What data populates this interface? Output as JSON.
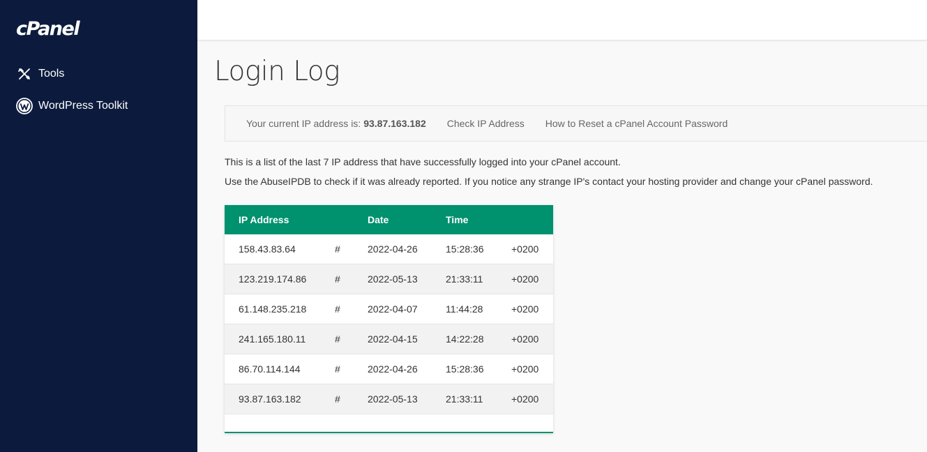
{
  "app": {
    "logo": "cPanel"
  },
  "sidebar": {
    "items": [
      {
        "label": "Tools",
        "icon": "tools-icon"
      },
      {
        "label": "WordPress Toolkit",
        "icon": "wordpress-icon"
      }
    ]
  },
  "page": {
    "title": "Login Log"
  },
  "info": {
    "ip_label": "Your current IP address is:",
    "ip_value": "93.87.163.182",
    "link_check": "Check IP Address",
    "link_reset": "How to Reset a cPanel Account Password"
  },
  "description": {
    "line1": "This is a list of the last 7 IP address that have successfully logged into your cPanel account.",
    "line2": "Use the AbuseIPDB to check if it was already reported. If you notice any strange IP's contact your hosting provider and change your cPanel password."
  },
  "table": {
    "headers": {
      "ip": "IP Address",
      "date": "Date",
      "time": "Time"
    },
    "rows": [
      {
        "ip": "158.43.83.64",
        "link": "#",
        "date": "2022-04-26",
        "time": "15:28:36",
        "tz": "+0200"
      },
      {
        "ip": "123.219.174.86",
        "link": "#",
        "date": "2022-05-13",
        "time": "21:33:11",
        "tz": "+0200"
      },
      {
        "ip": "61.148.235.218",
        "link": "#",
        "date": "2022-04-07",
        "time": "11:44:28",
        "tz": "+0200"
      },
      {
        "ip": "241.165.180.11",
        "link": "#",
        "date": "2022-04-15",
        "time": "14:22:28",
        "tz": "+0200"
      },
      {
        "ip": "86.70.114.144",
        "link": "#",
        "date": "2022-04-26",
        "time": "15:28:36",
        "tz": "+0200"
      },
      {
        "ip": "93.87.163.182",
        "link": "#",
        "date": "2022-05-13",
        "time": "21:33:11",
        "tz": "+0200"
      }
    ]
  },
  "colors": {
    "sidebar": "#0c1b3d",
    "accent": "#00916e"
  }
}
